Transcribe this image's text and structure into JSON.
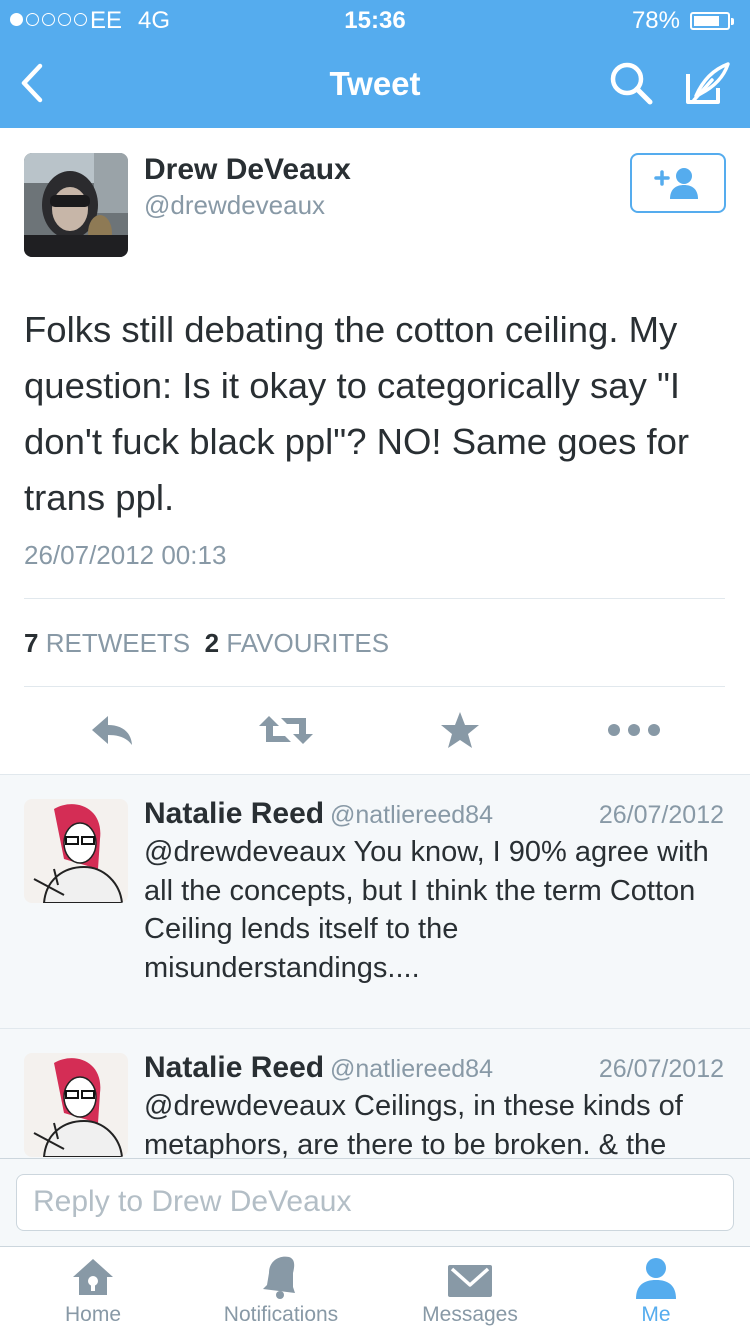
{
  "status_bar": {
    "carrier": "EE",
    "network": "4G",
    "time": "15:36",
    "battery": "78%",
    "battery_level": 0.78
  },
  "nav": {
    "title": "Tweet",
    "back_icon": "back-chevron-icon",
    "search_icon": "search-icon",
    "compose_icon": "compose-tweet-icon"
  },
  "tweet": {
    "author_name": "Drew DeVeaux",
    "author_handle": "@drewdeveaux",
    "follow_icon": "follow-user-icon",
    "text": "Folks still debating the cotton ceiling. My question: Is it okay to categorically say \"I don't fuck black ppl\"? NO! Same goes for trans ppl.",
    "timestamp": "26/07/2012 00:13",
    "retweets_count": "7",
    "retweets_label": "RETWEETS",
    "favourites_count": "2",
    "favourites_label": "FAVOURITES"
  },
  "actions": [
    "reply-icon",
    "retweet-icon",
    "favourite-star-icon",
    "more-icon"
  ],
  "replies": [
    {
      "name": "Natalie Reed",
      "handle": "@natliereed84",
      "date": "26/07/2012",
      "text": "@drewdeveaux You know, I 90% agree with all the concepts, but I think the term Cotton Ceiling lends itself to the misunderstandings...."
    },
    {
      "name": "Natalie Reed",
      "handle": "@natliereed84",
      "date": "26/07/2012",
      "text": "@drewdeveaux Ceilings, in these kinds of metaphors, are there to be broken. & the"
    }
  ],
  "composer": {
    "placeholder": "Reply to Drew DeVeaux"
  },
  "tabs": [
    {
      "label": "Home",
      "icon": "home-icon"
    },
    {
      "label": "Notifications",
      "icon": "bell-icon"
    },
    {
      "label": "Messages",
      "icon": "envelope-icon"
    },
    {
      "label": "Me",
      "icon": "person-icon",
      "active": true
    }
  ],
  "colors": {
    "brand_blue": "#55acee",
    "text_dark": "#292f33",
    "text_gray": "#8899a6",
    "reply_bg": "#f5f8fa"
  }
}
